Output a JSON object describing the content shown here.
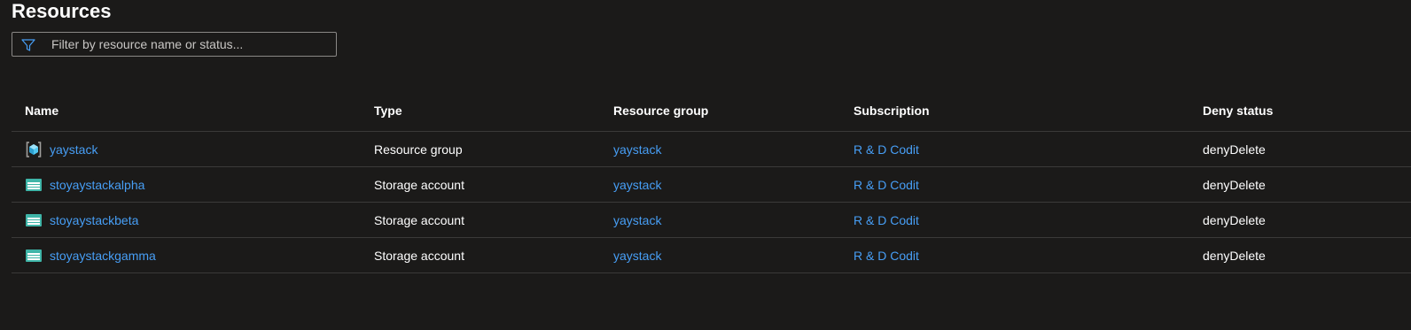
{
  "page": {
    "title": "Resources"
  },
  "filter": {
    "placeholder": "Filter by resource name or status...",
    "icon": "filter-icon"
  },
  "table": {
    "columns": [
      "Name",
      "Type",
      "Resource group",
      "Subscription",
      "Deny status"
    ],
    "rows": [
      {
        "icon": "resource-group-icon",
        "name": "yaystack",
        "type": "Resource group",
        "resource_group": "yaystack",
        "subscription": "R & D Codit",
        "deny_status": "denyDelete"
      },
      {
        "icon": "storage-account-icon",
        "name": "stoyaystackalpha",
        "type": "Storage account",
        "resource_group": "yaystack",
        "subscription": "R & D Codit",
        "deny_status": "denyDelete"
      },
      {
        "icon": "storage-account-icon",
        "name": "stoyaystackbeta",
        "type": "Storage account",
        "resource_group": "yaystack",
        "subscription": "R & D Codit",
        "deny_status": "denyDelete"
      },
      {
        "icon": "storage-account-icon",
        "name": "stoyaystackgamma",
        "type": "Storage account",
        "resource_group": "yaystack",
        "subscription": "R & D Codit",
        "deny_status": "denyDelete"
      }
    ]
  },
  "colors": {
    "background": "#1b1a19",
    "link": "#479ef5",
    "divider": "#3b3a39",
    "storage_icon": "#3fb5a8",
    "resource_group_icon": "#50c7f0"
  }
}
